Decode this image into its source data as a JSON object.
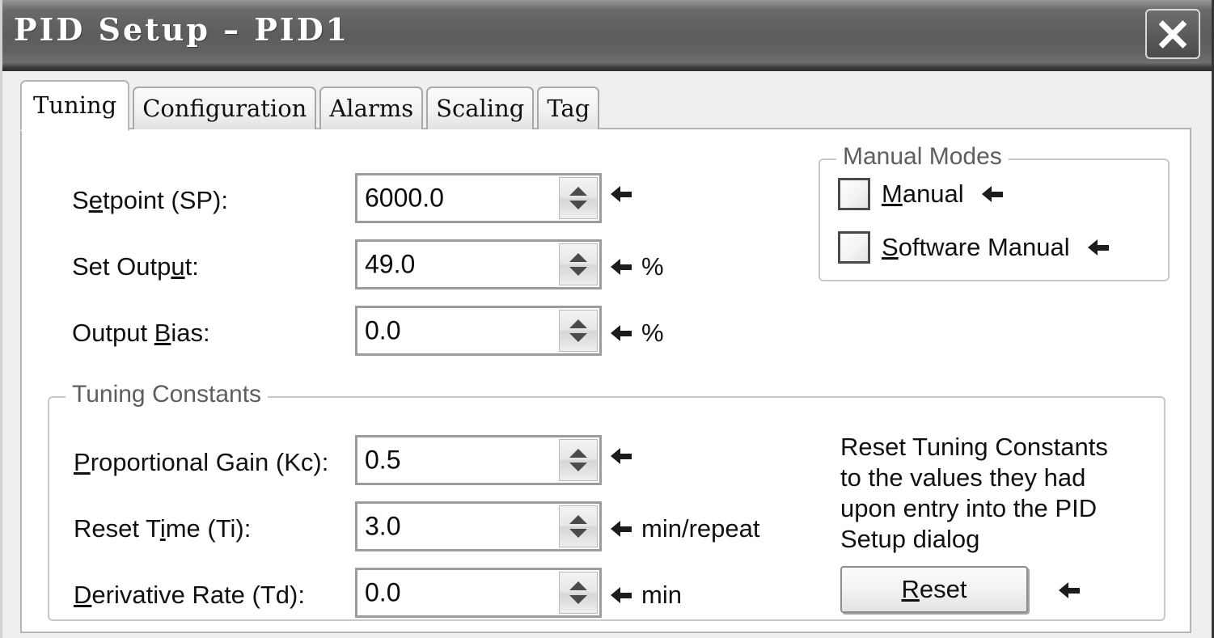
{
  "window": {
    "title": "PID Setup – PID1",
    "close_icon": "close-icon"
  },
  "tabs": [
    {
      "label": "Tuning",
      "active": true
    },
    {
      "label": "Configuration",
      "active": false
    },
    {
      "label": "Alarms",
      "active": false
    },
    {
      "label": "Scaling",
      "active": false
    },
    {
      "label": "Tag",
      "active": false
    }
  ],
  "fields": {
    "setpoint": {
      "label_pre": "S",
      "label_mnemonic": "e",
      "label_post": "tpoint (SP):",
      "value": "6000.0",
      "unit": ""
    },
    "set_output": {
      "label_pre": "Set Outp",
      "label_mnemonic": "u",
      "label_post": "t:",
      "value": "49.0",
      "unit": "%"
    },
    "output_bias": {
      "label_pre": "Output ",
      "label_mnemonic": "B",
      "label_post": "ias:",
      "value": "0.0",
      "unit": "%"
    },
    "proportional_gain": {
      "label_pre": "",
      "label_mnemonic": "P",
      "label_post": "roportional Gain (Kc):",
      "value": "0.5",
      "unit": ""
    },
    "reset_time": {
      "label_pre": "Reset T",
      "label_mnemonic": "i",
      "label_post": "me (Ti):",
      "value": "3.0",
      "unit": "min/repeat"
    },
    "derivative_rate": {
      "label_pre": "",
      "label_mnemonic": "D",
      "label_post": "erivative Rate (Td):",
      "value": "0.0",
      "unit": "min"
    }
  },
  "manual_modes": {
    "legend": "Manual Modes",
    "manual": {
      "label_pre": "",
      "label_mnemonic": "M",
      "label_post": "anual",
      "checked": false
    },
    "software_manual": {
      "label_pre": "",
      "label_mnemonic": "S",
      "label_post": "oftware Manual",
      "checked": false
    }
  },
  "tuning_constants": {
    "legend": "Tuning Constants",
    "help_text": "Reset Tuning Constants\nto the values they had\nupon entry into the PID\nSetup dialog",
    "reset_button": {
      "label_pre": "",
      "label_mnemonic": "R",
      "label_post": "eset"
    }
  },
  "colors": {
    "dialog_bg": "#efefef",
    "panel_bg": "#ffffff",
    "titlebar_dark": "#5c5c5c",
    "field_border": "#9c9c9c",
    "group_border": "#c9c9c9",
    "legend_text": "#5e5e5e"
  }
}
